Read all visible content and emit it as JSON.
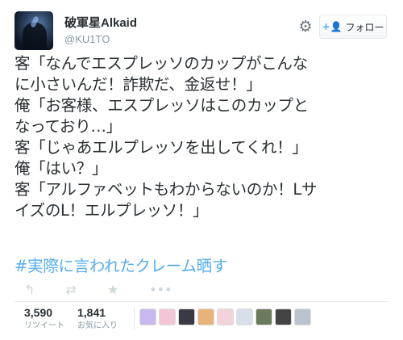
{
  "user": {
    "display_name": "破軍星Alkaid",
    "screen_name": "@KU1TO",
    "avatar_icon": "avatar-image"
  },
  "follow": {
    "label": "フォロー",
    "icon": "add-user-icon"
  },
  "settings": {
    "icon": "gear-icon",
    "glyph": "⚙"
  },
  "tweet": {
    "lines": [
      "客「なんでエスプレッソのカップがこんな",
      "に小さいんだ！詐欺だ、金返せ！」",
      "俺「お客様、エスプレッソはこのカップと",
      "なっており…」",
      "客「じゃあエルプレッソを出してくれ！」",
      "俺「はい？」",
      "客「アルファベットもわからないのか！Lサ",
      "イズのL！エルプレッソ！」"
    ],
    "hashtag": "#実際に言われたクレーム晒す"
  },
  "actions": {
    "reply": {
      "icon": "reply-icon",
      "glyph": "↰"
    },
    "retweet": {
      "icon": "retweet-icon",
      "glyph": "⇄"
    },
    "favorite": {
      "icon": "star-icon",
      "glyph": "★"
    },
    "more": {
      "icon": "more-icon",
      "glyph": "•••"
    }
  },
  "stats": {
    "retweets": {
      "count": "3,590",
      "label": "リツイート"
    },
    "favorites": {
      "count": "1,841",
      "label": "お気に入り"
    }
  },
  "likers": [
    "#c9b8f0",
    "#f2c6d6",
    "#3a3a44",
    "#e8b27a",
    "#f4d2d9",
    "#d8dfe8",
    "#6b7a5a",
    "#444444",
    "#b9c4cf"
  ]
}
